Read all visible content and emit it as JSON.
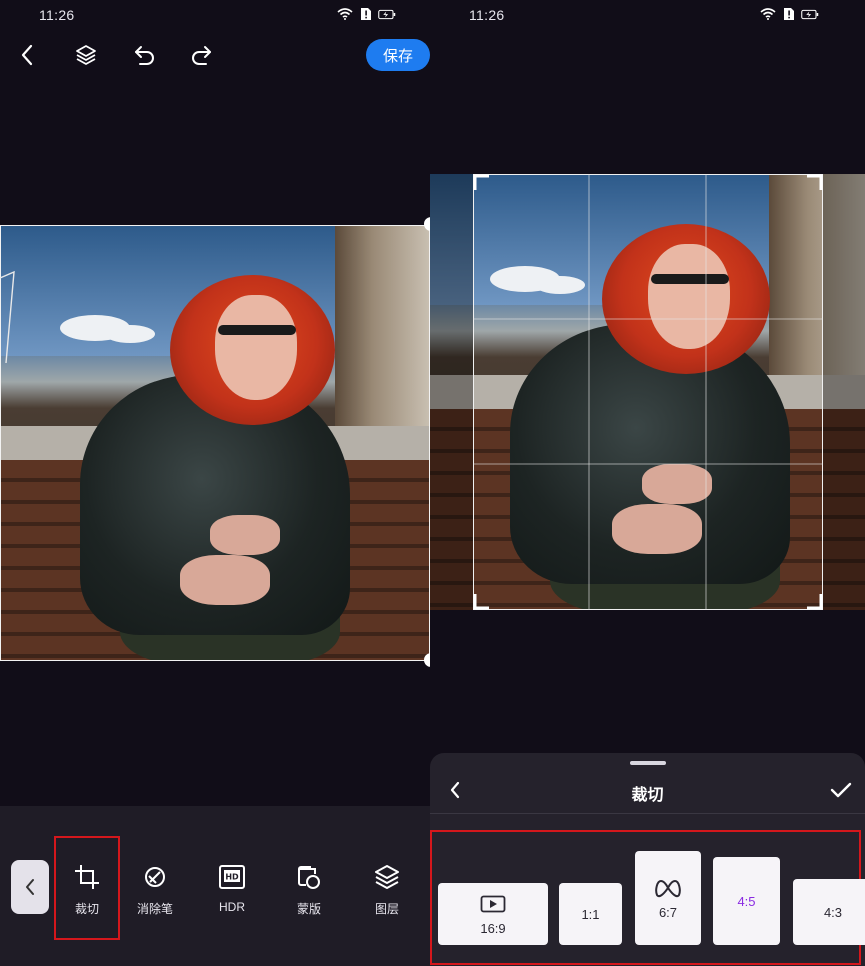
{
  "left_screen": {
    "status_time": "11:26",
    "toolbar": {
      "save_label": "保存"
    },
    "tools": [
      {
        "label": "裁切",
        "icon": "crop-icon"
      },
      {
        "label": "消除笔",
        "icon": "eraser-icon"
      },
      {
        "label": "HDR",
        "icon": "hdr-icon"
      },
      {
        "label": "蒙版",
        "icon": "mask-icon"
      },
      {
        "label": "图层",
        "icon": "layers-icon"
      }
    ]
  },
  "right_screen": {
    "status_time": "11:26",
    "sheet": {
      "title": "裁切",
      "ratios": [
        {
          "label": "16:9",
          "icon": "video-play-icon",
          "selected": false
        },
        {
          "label": "1:1",
          "icon": "",
          "selected": false
        },
        {
          "label": "6:7",
          "icon": "meta-logo-icon",
          "selected": false
        },
        {
          "label": "4:5",
          "icon": "",
          "selected": true
        },
        {
          "label": "4:3",
          "icon": "",
          "selected": false
        }
      ]
    }
  },
  "colors": {
    "accent": "#1e7cf0",
    "highlight_box": "#d4171c",
    "selected_ratio": "#8a2be2",
    "background": "#110d18"
  }
}
